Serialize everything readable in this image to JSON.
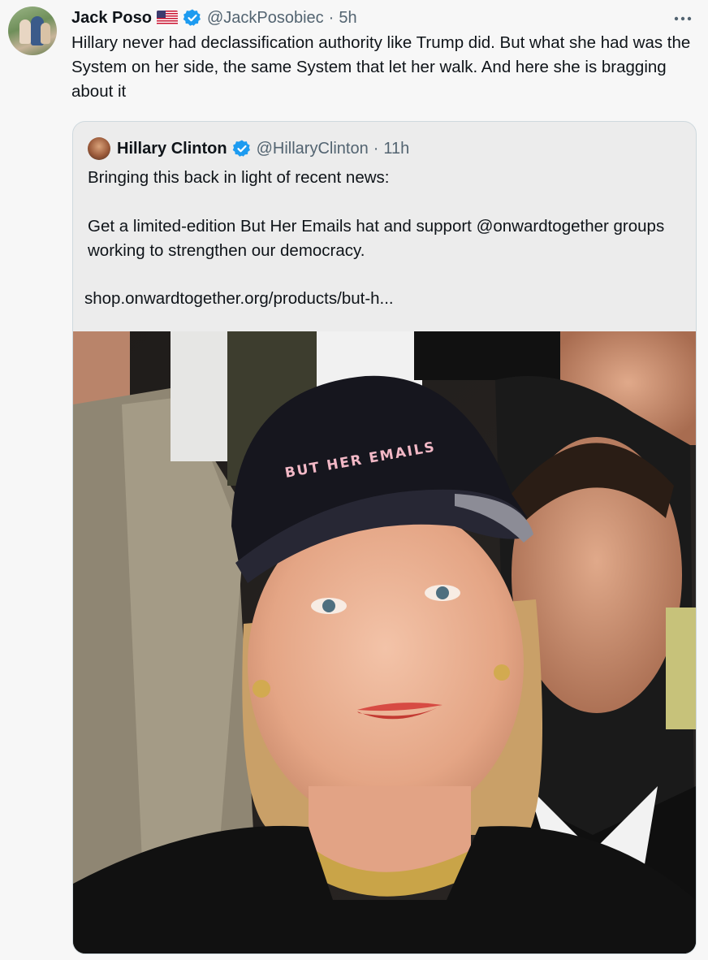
{
  "tweet": {
    "author_name": "Jack Poso",
    "author_flag": "🇺🇸",
    "author_handle": "@JackPosobiec",
    "separator": "·",
    "time": "5h",
    "text": "Hillary never had declassification authority like Trump did. But what she had was the System on her side, the same System that let her walk. And here she is bragging about it",
    "more_icon": "more-horizontal-icon"
  },
  "quote": {
    "author_name": "Hillary Clinton",
    "author_handle": "@HillaryClinton",
    "separator": "·",
    "time": "11h",
    "paragraphs": [
      "Bringing this back in light of recent news:",
      "Get a limited-edition But Her Emails hat and support @onwardtogether groups working to strengthen our democracy."
    ],
    "link": "shop.onwardtogether.org/products/but-h...",
    "image_hat_text": "BUT HER EMAILS"
  },
  "colors": {
    "verified_blue": "#1d9bf0",
    "secondary_text": "#536471",
    "card_border": "#cfd9de"
  }
}
